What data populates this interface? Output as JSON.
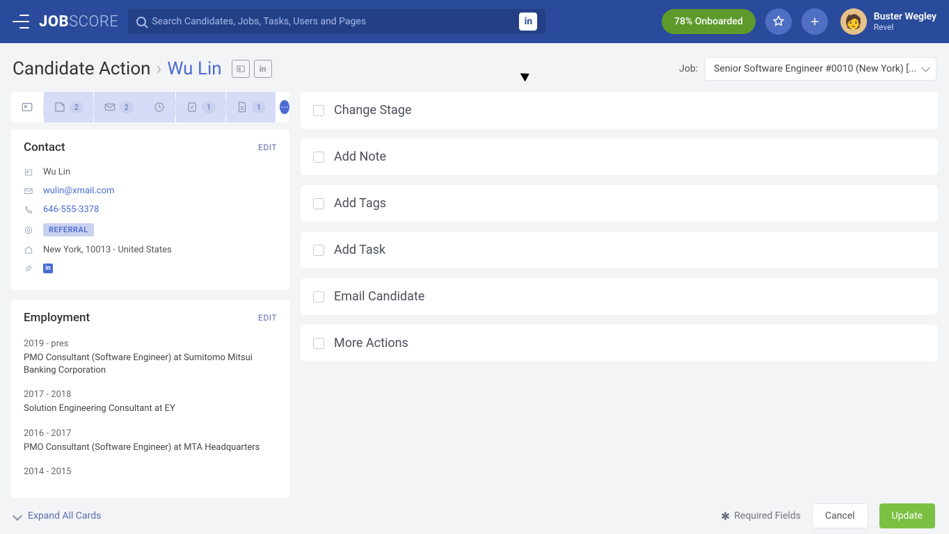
{
  "topnav": {
    "logo_primary": "JOB",
    "logo_secondary": "SCORE",
    "search_placeholder": "Search Candidates, Jobs, Tasks, Users and Pages",
    "linkedin_glyph": "in",
    "onboarded_label": "78% Onboarded"
  },
  "user": {
    "name": "Buster Wegley",
    "org": "Revel"
  },
  "breadcrumb": {
    "root": "Candidate Action",
    "candidate": "Wu Lin"
  },
  "job": {
    "label": "Job:",
    "value": "Senior Software Engineer #0010 (New York) [..."
  },
  "tabs": {
    "notes_count": "2",
    "emails_count": "2",
    "tasks_count": "1",
    "files_count": "1"
  },
  "contact": {
    "title": "Contact",
    "edit": "EDIT",
    "name": "Wu Lin",
    "email": "wulin@xmail.com",
    "phone": "646-555-3378",
    "source_badge": "REFERRAL",
    "location": "New York, 10013 - United States"
  },
  "employment": {
    "title": "Employment",
    "edit": "EDIT",
    "items": [
      {
        "dates": "2019 - pres",
        "title": "PMO Consultant (Software Engineer) at Sumitomo Mitsui Banking Corporation"
      },
      {
        "dates": "2017 - 2018",
        "title": "Solution Engineering Consultant at EY"
      },
      {
        "dates": "2016 - 2017",
        "title": "PMO Consultant (Software Engineer) at MTA Headquarters"
      },
      {
        "dates": "2014 - 2015",
        "title": ""
      }
    ]
  },
  "actions": {
    "change_stage": "Change Stage",
    "add_note": "Add Note",
    "add_tags": "Add Tags",
    "add_task": "Add Task",
    "email_candidate": "Email Candidate",
    "more_actions": "More Actions"
  },
  "footer": {
    "expand_all": "Expand All Cards",
    "required": "Required Fields",
    "cancel": "Cancel",
    "update": "Update"
  }
}
